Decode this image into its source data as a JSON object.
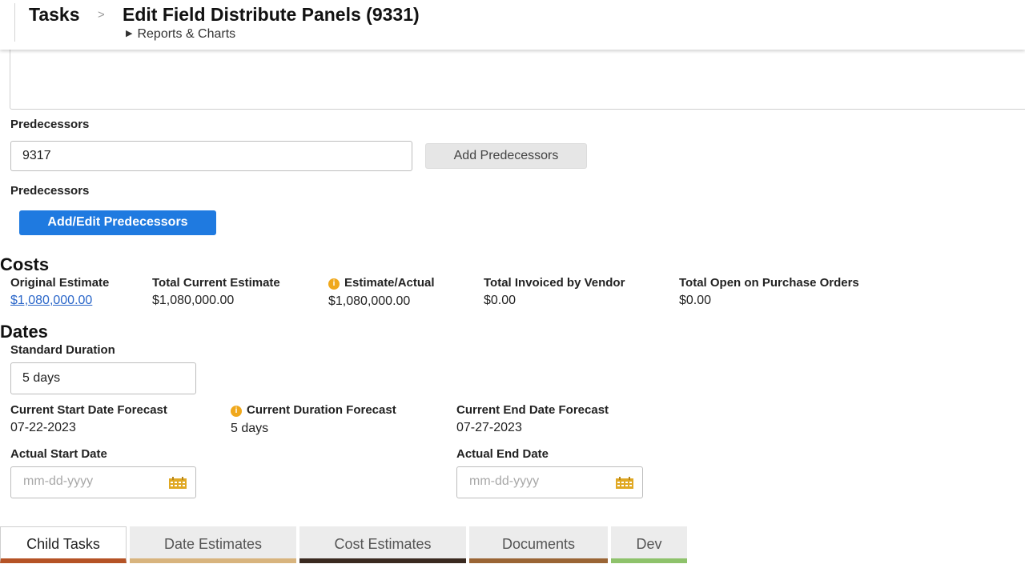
{
  "header": {
    "breadcrumb_root": "Tasks",
    "separator": ">",
    "title": "Edit Field Distribute Panels (9331)",
    "reports_toggle": "Reports & Charts"
  },
  "predecessors": {
    "label1": "Predecessors",
    "input_value": "9317",
    "add_button": "Add Predecessors",
    "label2": "Predecessors",
    "add_edit_button": "Add/Edit Predecessors"
  },
  "costs": {
    "title": "Costs",
    "columns": [
      {
        "label": "Original Estimate",
        "value": "$1,080,000.00"
      },
      {
        "label": "Total Current Estimate",
        "value": "$1,080,000.00"
      },
      {
        "label": "Estimate/Actual",
        "value": "$1,080,000.00"
      },
      {
        "label": "Total Invoiced by Vendor",
        "value": "$0.00"
      },
      {
        "label": "Total Open on Purchase Orders",
        "value": "$0.00"
      }
    ]
  },
  "dates": {
    "title": "Dates",
    "standard_duration_label": "Standard Duration",
    "standard_duration_value": "5 days",
    "forecast": [
      {
        "label": "Current Start Date Forecast",
        "value": "07-22-2023"
      },
      {
        "label": "Current Duration Forecast",
        "value": "5 days"
      },
      {
        "label": "Current End Date Forecast",
        "value": "07-27-2023"
      }
    ],
    "actual_start_label": "Actual Start Date",
    "actual_start_placeholder": "mm-dd-yyyy",
    "actual_end_label": "Actual End Date",
    "actual_end_placeholder": "mm-dd-yyyy"
  },
  "tabs": [
    {
      "label": "Child Tasks",
      "color": "#b55326"
    },
    {
      "label": "Date Estimates",
      "color": "#d8b47e"
    },
    {
      "label": "Cost Estimates",
      "color": "#3a2a20"
    },
    {
      "label": "Documents",
      "color": "#9a6535"
    },
    {
      "label": "Dev",
      "color": "#8ec26b"
    }
  ],
  "colors": {
    "primary_button": "#1f7ae0",
    "link": "#2a66c9",
    "info_icon": "#f0a81c",
    "calendar_icon": "#e0a823"
  }
}
